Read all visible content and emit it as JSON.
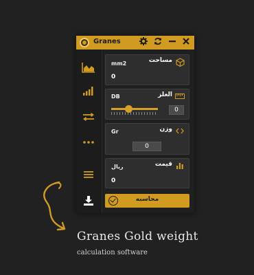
{
  "app": {
    "title": "Granes"
  },
  "colors": {
    "accent": "#d19b22",
    "panel": "#2e2e2e",
    "background": "#212121"
  },
  "titlebar": {
    "icons": [
      "gear-icon",
      "refresh-icon",
      "minimize-icon",
      "close-icon"
    ]
  },
  "sidebar": {
    "items": [
      {
        "name": "area-chart-icon"
      },
      {
        "name": "signal-bars-icon"
      },
      {
        "name": "swap-arrows-icon"
      },
      {
        "name": "more-dots-icon"
      },
      {
        "name": "menu-icon"
      },
      {
        "name": "download-icon"
      }
    ]
  },
  "panels": {
    "area": {
      "title": "مساحت",
      "unit": "mm2",
      "value": "0"
    },
    "thickness": {
      "title": "الغلز",
      "unit": "DB",
      "value": "0",
      "slider_percent": 38
    },
    "weight": {
      "title": "وزن",
      "unit": "Gr",
      "value": "0"
    },
    "price": {
      "title": "قیمت",
      "unit": "ریال",
      "value": "0"
    }
  },
  "calculate": {
    "label": "محاسبه"
  },
  "caption": {
    "title": "Granes Gold weight",
    "subtitle": "calculation software"
  }
}
